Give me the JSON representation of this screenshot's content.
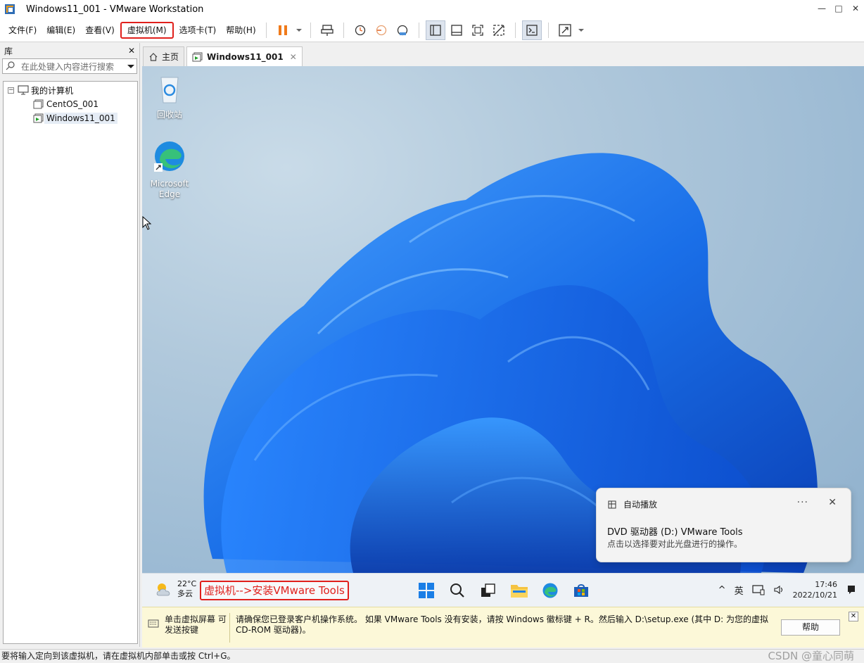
{
  "window": {
    "title": "Windows11_001 - VMware Workstation",
    "min": "—",
    "max": "□",
    "close": "✕"
  },
  "menu": {
    "items": [
      {
        "label": "文件(F)"
      },
      {
        "label": "编辑(E)"
      },
      {
        "label": "查看(V)"
      },
      {
        "label": "虚拟机(M)"
      },
      {
        "label": "选项卡(T)"
      },
      {
        "label": "帮助(H)"
      }
    ]
  },
  "library": {
    "title": "库",
    "close": "✕",
    "search_placeholder": "在此处键入内容进行搜索",
    "tree": {
      "root": "我的计算机",
      "expander": "−",
      "children": [
        "CentOS_001",
        "Windows11_001"
      ]
    }
  },
  "tabs": [
    {
      "label": "主页"
    },
    {
      "label": "Windows11_001",
      "close": "✕"
    }
  ],
  "desktop": {
    "icons": [
      {
        "label": "回收站"
      },
      {
        "label": "Microsoft Edge"
      }
    ]
  },
  "toast": {
    "app": "自动播放",
    "more": "···",
    "close": "✕",
    "title": "DVD 驱动器 (D:) VMware Tools",
    "body": "点击以选择要对此光盘进行的操作。"
  },
  "taskbar": {
    "weather_temp": "22°C",
    "weather_desc": "多云",
    "annotation": "虚拟机-->安装VMware Tools",
    "tray_chevron": "^",
    "ime": "英",
    "time": "17:46",
    "date": "2022/10/21"
  },
  "hint": {
    "left": "单击虚拟屏幕 可发送按键",
    "message": "请确保您已登录客户机操作系统。 如果 VMware Tools 没有安装，请按 Windows 徽标键 + R。然后输入 D:\\setup.exe (其中 D: 为您的虚拟 CD-ROM 驱动器)。",
    "button": "帮助",
    "close": "✕"
  },
  "status": {
    "text": "要将输入定向到该虚拟机，请在虚拟机内部单击或按 Ctrl+G。",
    "watermark": "CSDN @童心同萌"
  },
  "colors": {
    "highlight": "#e0201c",
    "accent": "#0a66c2",
    "hint_bg": "#fcf8d8"
  }
}
